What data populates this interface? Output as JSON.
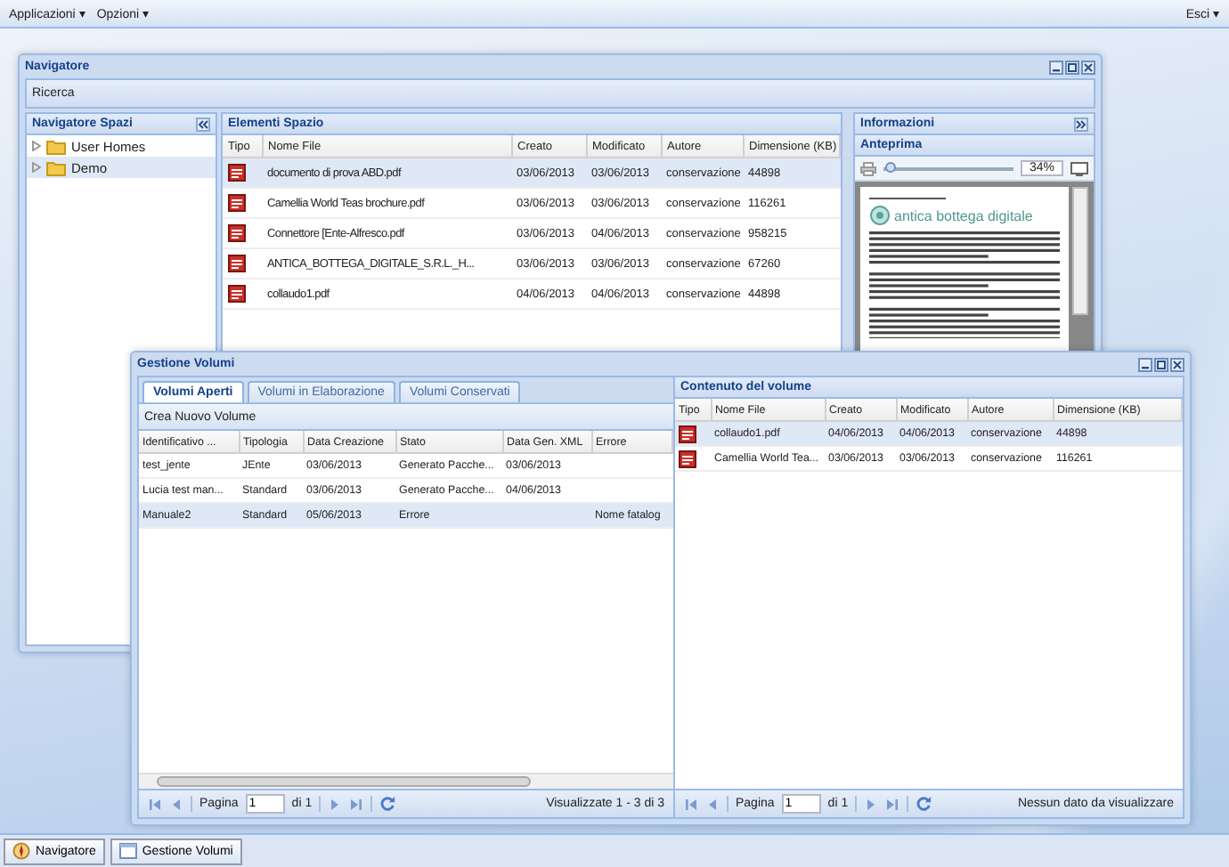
{
  "menu_bar": {
    "items": [
      {
        "label": "Applicazioni ▾"
      },
      {
        "label": "Opzioni ▾"
      }
    ],
    "exit": "Esci ▾"
  },
  "navigator_window": {
    "title": "Navigatore",
    "toolbar": "Ricerca",
    "tree": {
      "title": "Navigatore Spazi",
      "items": [
        {
          "label": "User Homes",
          "selected": false
        },
        {
          "label": "Demo",
          "selected": true
        }
      ]
    },
    "files": {
      "title": "Elementi Spazio",
      "columns": [
        "Tipo",
        "Nome File",
        "Creato",
        "Modificato",
        "Autore",
        "Dimensione (KB)"
      ],
      "rows": [
        {
          "name": "documento di prova ABD.pdf",
          "created": "03/06/2013",
          "modified": "03/06/2013",
          "author": "conservazione",
          "size": "44898",
          "selected": true
        },
        {
          "name": "Camellia World Teas brochure.pdf",
          "created": "03/06/2013",
          "modified": "03/06/2013",
          "author": "conservazione",
          "size": "116261",
          "selected": false
        },
        {
          "name": "Connettore [Ente-Alfresco.pdf",
          "created": "03/06/2013",
          "modified": "04/06/2013",
          "author": "conservazione",
          "size": "958215",
          "selected": false
        },
        {
          "name": "ANTICA_BOTTEGA_DIGITALE_S.R.L._H...",
          "created": "03/06/2013",
          "modified": "03/06/2013",
          "author": "conservazione",
          "size": "67260",
          "selected": false
        },
        {
          "name": "collaudo1.pdf",
          "created": "04/06/2013",
          "modified": "04/06/2013",
          "author": "conservazione",
          "size": "44898",
          "selected": false
        }
      ]
    },
    "info": {
      "title": "Informazioni",
      "preview_title": "Anteprima",
      "zoom": {
        "reading": "34%",
        "level": 0.05
      },
      "document_heading": "antica bottega digitale"
    }
  },
  "volumes_window": {
    "title": "Gestione Volumi",
    "tabs": [
      {
        "label": "Volumi Aperti",
        "selected": true
      },
      {
        "label": "Volumi in Elaborazione",
        "selected": false
      },
      {
        "label": "Volumi Conservati",
        "selected": false
      }
    ],
    "toolbar": "Crea Nuovo Volume",
    "columns": [
      "Identificativo ...",
      "Tipologia",
      "Data Creazione",
      "Stato",
      "Data Gen. XML",
      "Errore"
    ],
    "rows": [
      {
        "id": "test_jente",
        "type": "JEnte",
        "created": "03/06/2013",
        "state": "Generato Pacche...",
        "xml_date": "03/06/2013",
        "selected": false
      },
      {
        "id": "Lucia test man...",
        "type": "Standard",
        "created": "03/06/2013",
        "state": "Generato Pacche...",
        "xml_date": "04/06/2013",
        "selected": false
      },
      {
        "id": "Manuale2",
        "type": "Standard",
        "created": "05/06/2013",
        "state": "Errore",
        "error": "Nome fatalog",
        "selected": true
      }
    ],
    "pager": {
      "page_label": "Pagina",
      "page": "1",
      "of": "di 1",
      "summary": "Visualizzate 1 - 3 di 3"
    },
    "content": {
      "title": "Contenuto del volume",
      "columns": [
        "Tipo",
        "Nome File",
        "Creato",
        "Modificato",
        "Autore",
        "Dimensione (KB)"
      ],
      "rows": [
        {
          "name": "collaudo1.pdf",
          "created": "04/06/2013",
          "modified": "04/06/2013",
          "author": "conservazione",
          "size": "44898",
          "selected": true
        },
        {
          "name": "Camellia World Tea...",
          "created": "03/06/2013",
          "modified": "03/06/2013",
          "author": "conservazione",
          "size": "116261",
          "selected": false
        }
      ],
      "pager": {
        "page_label": "Pagina",
        "page": "1",
        "of": "di 1",
        "summary": "Nessun dato da visualizzare"
      }
    }
  },
  "taskbar": [
    {
      "label": "Navigatore",
      "kind": "navigator"
    },
    {
      "label": "Gestione Volumi",
      "kind": "window"
    }
  ]
}
